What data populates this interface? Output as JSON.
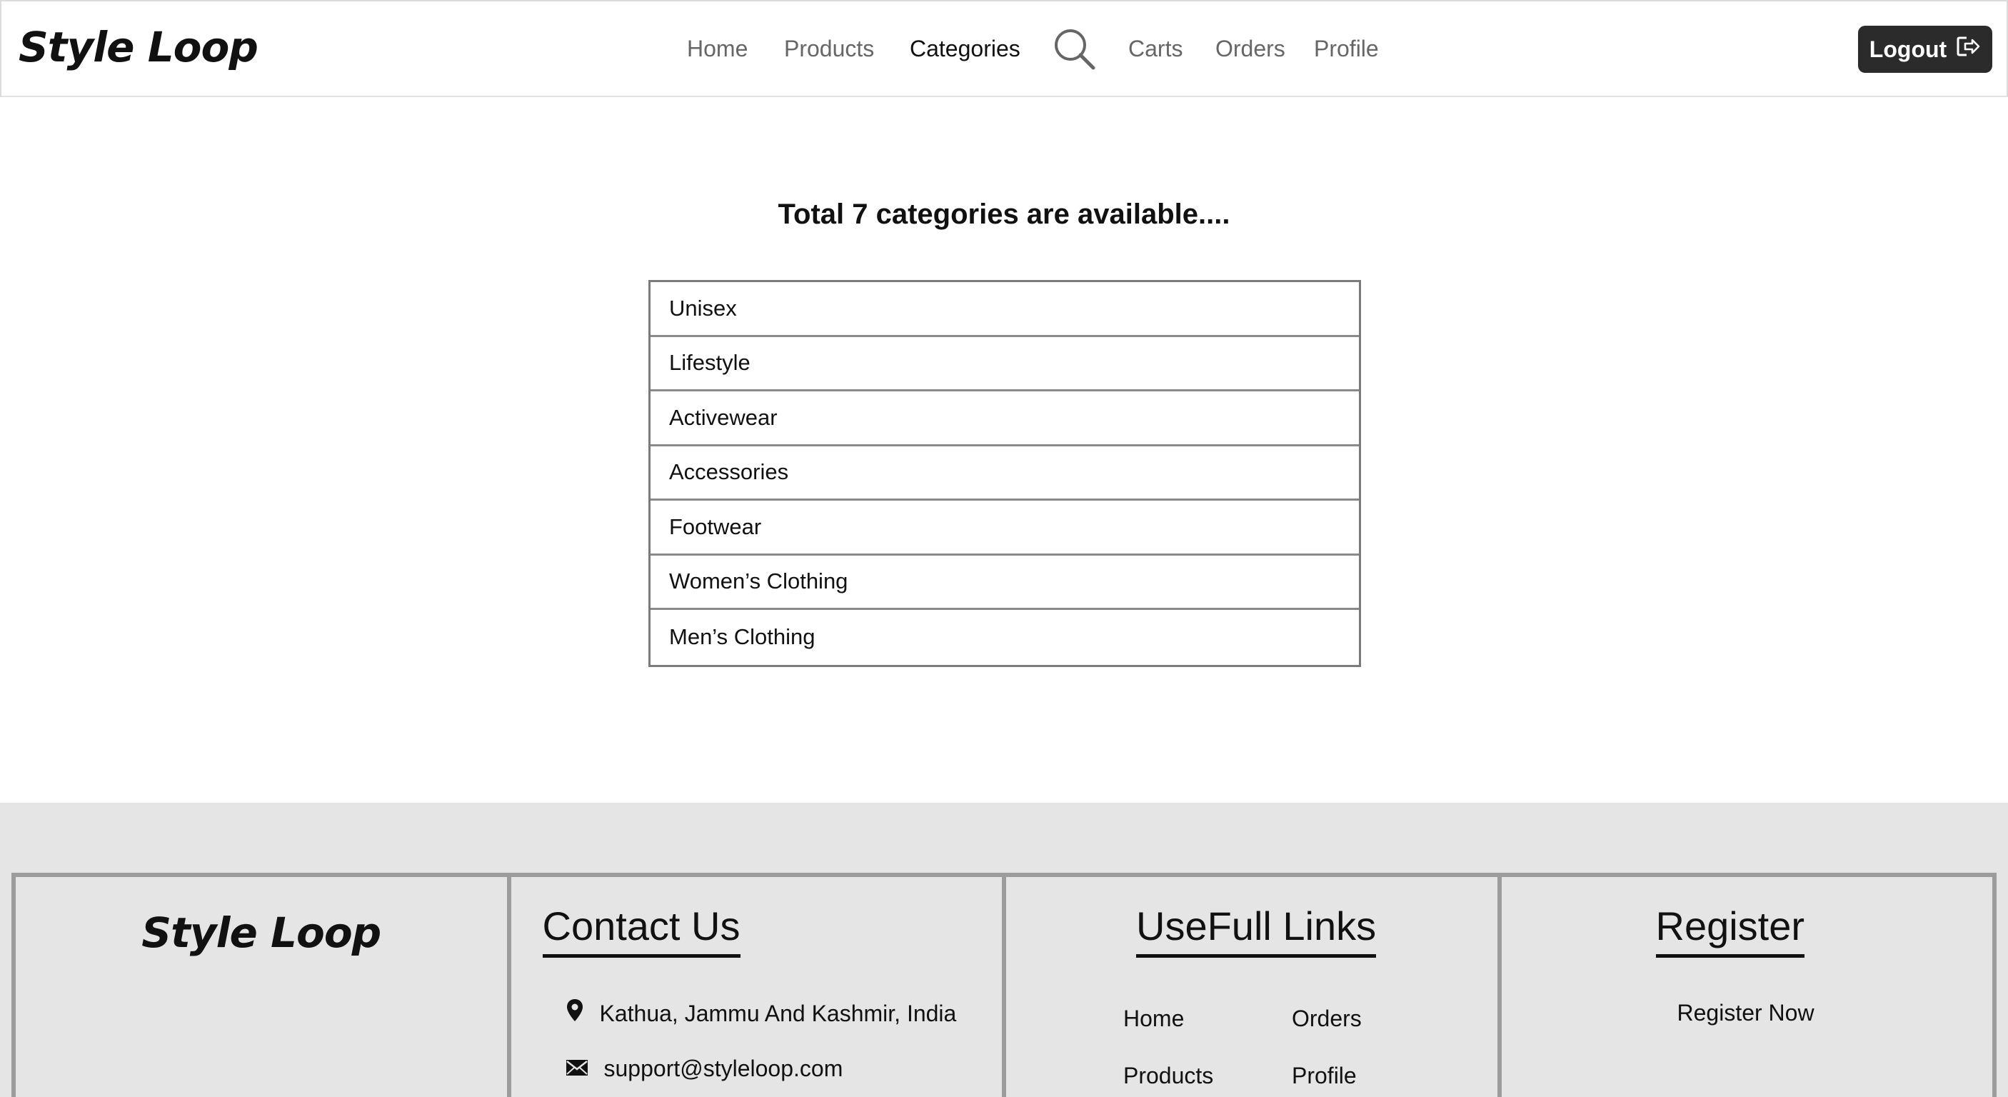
{
  "header": {
    "brand": "Style Loop",
    "nav": [
      "Home",
      "Products",
      "Categories",
      "Carts",
      "Orders",
      "Profile"
    ],
    "active_nav": "Categories",
    "search_icon": "search-icon",
    "logout_label": "Logout",
    "logout_icon": "logout-icon"
  },
  "main": {
    "title": "Total 7 categories are available....",
    "categories": [
      "Unisex",
      "Lifestyle",
      "Activewear",
      "Accessories",
      "Footwear",
      "Women’s Clothing",
      "Men’s Clothing"
    ]
  },
  "footer": {
    "brand": "Style Loop",
    "contact": {
      "heading": "Contact Us",
      "address": "Kathua, Jammu And Kashmir, India",
      "email": "support@styleloop.com",
      "address_icon": "location-pin-icon",
      "email_icon": "mail-icon"
    },
    "links": {
      "heading": "UseFull Links",
      "items": [
        "Home",
        "Orders",
        "Products",
        "Profile"
      ]
    },
    "register": {
      "heading": "Register",
      "link": "Register Now"
    }
  },
  "colors": {
    "header_bg": "#ffffff",
    "footer_bg": "#e5e5e5",
    "button_bg": "#2b2b2b",
    "border": "#9c9c9c"
  }
}
